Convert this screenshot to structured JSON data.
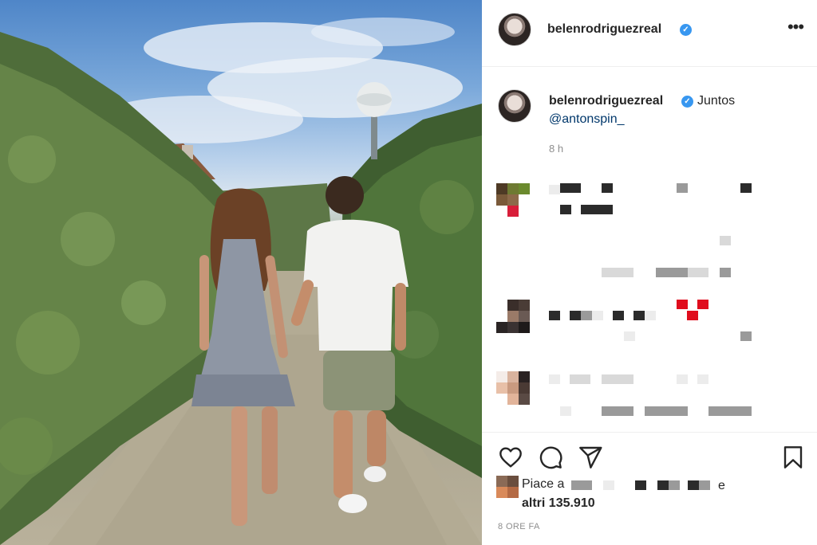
{
  "post": {
    "username": "belenrodriguezreal",
    "verified_mark": "✓",
    "more_label": "•••",
    "caption_text": "Juntos",
    "caption_mention": "@antonspin_",
    "caption_time": "8 h",
    "likes_prefix": "Piace a",
    "likes_joiner": "e",
    "likes_count": "altri 135.910",
    "post_time": "8 ORE FA"
  },
  "icons": {
    "more": "more-horizontal-icon",
    "verified": "verified-badge-icon",
    "like": "heart-icon",
    "comment": "comment-bubble-icon",
    "share": "paper-plane-icon",
    "save": "bookmark-icon"
  },
  "colors": {
    "text": "#262626",
    "secondary": "#8e8e8e",
    "link": "#00376b",
    "verified": "#3897f0",
    "divider": "#efefef"
  }
}
